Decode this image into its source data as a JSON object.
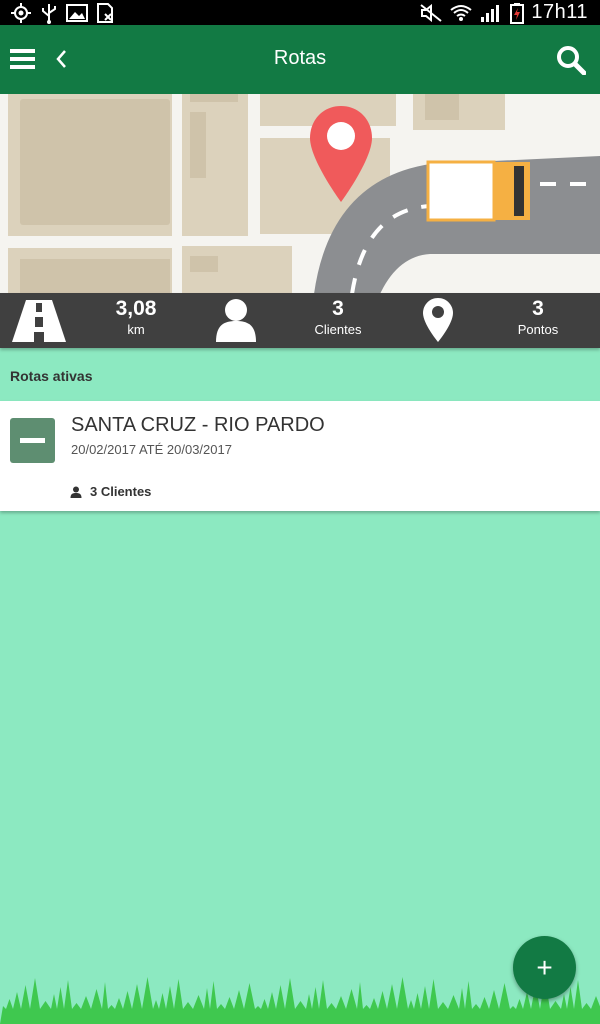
{
  "status_bar": {
    "time": "17h11",
    "icons_left": [
      "gps-icon",
      "usb-icon",
      "image-icon",
      "sim-off-icon"
    ],
    "icons_right": [
      "mute-icon",
      "wifi-icon",
      "signal-icon",
      "battery-charging-icon"
    ]
  },
  "app_bar": {
    "title": "Rotas",
    "menu_icon": "hamburger-menu-icon",
    "back_icon": "chevron-left-icon",
    "search_icon": "search-icon"
  },
  "stats": {
    "distance": {
      "value": "3,08",
      "label": "km",
      "icon": "road-icon"
    },
    "clients": {
      "value": "3",
      "label": "Clientes",
      "icon": "person-icon"
    },
    "points": {
      "value": "3",
      "label": "Pontos",
      "icon": "map-pin-icon"
    }
  },
  "section": {
    "title": "Rotas ativas"
  },
  "routes": [
    {
      "name": "SANTA CRUZ - RIO PARDO",
      "dates": "20/02/2017 ATÉ 20/03/2017",
      "clients": "3 Clientes"
    }
  ],
  "fab": {
    "label": "+"
  },
  "colors": {
    "primary": "#127a44",
    "background": "#8ce9c1",
    "stats_bar": "#404040",
    "pin": "#f05a5b",
    "toggle": "#5e8e71"
  }
}
